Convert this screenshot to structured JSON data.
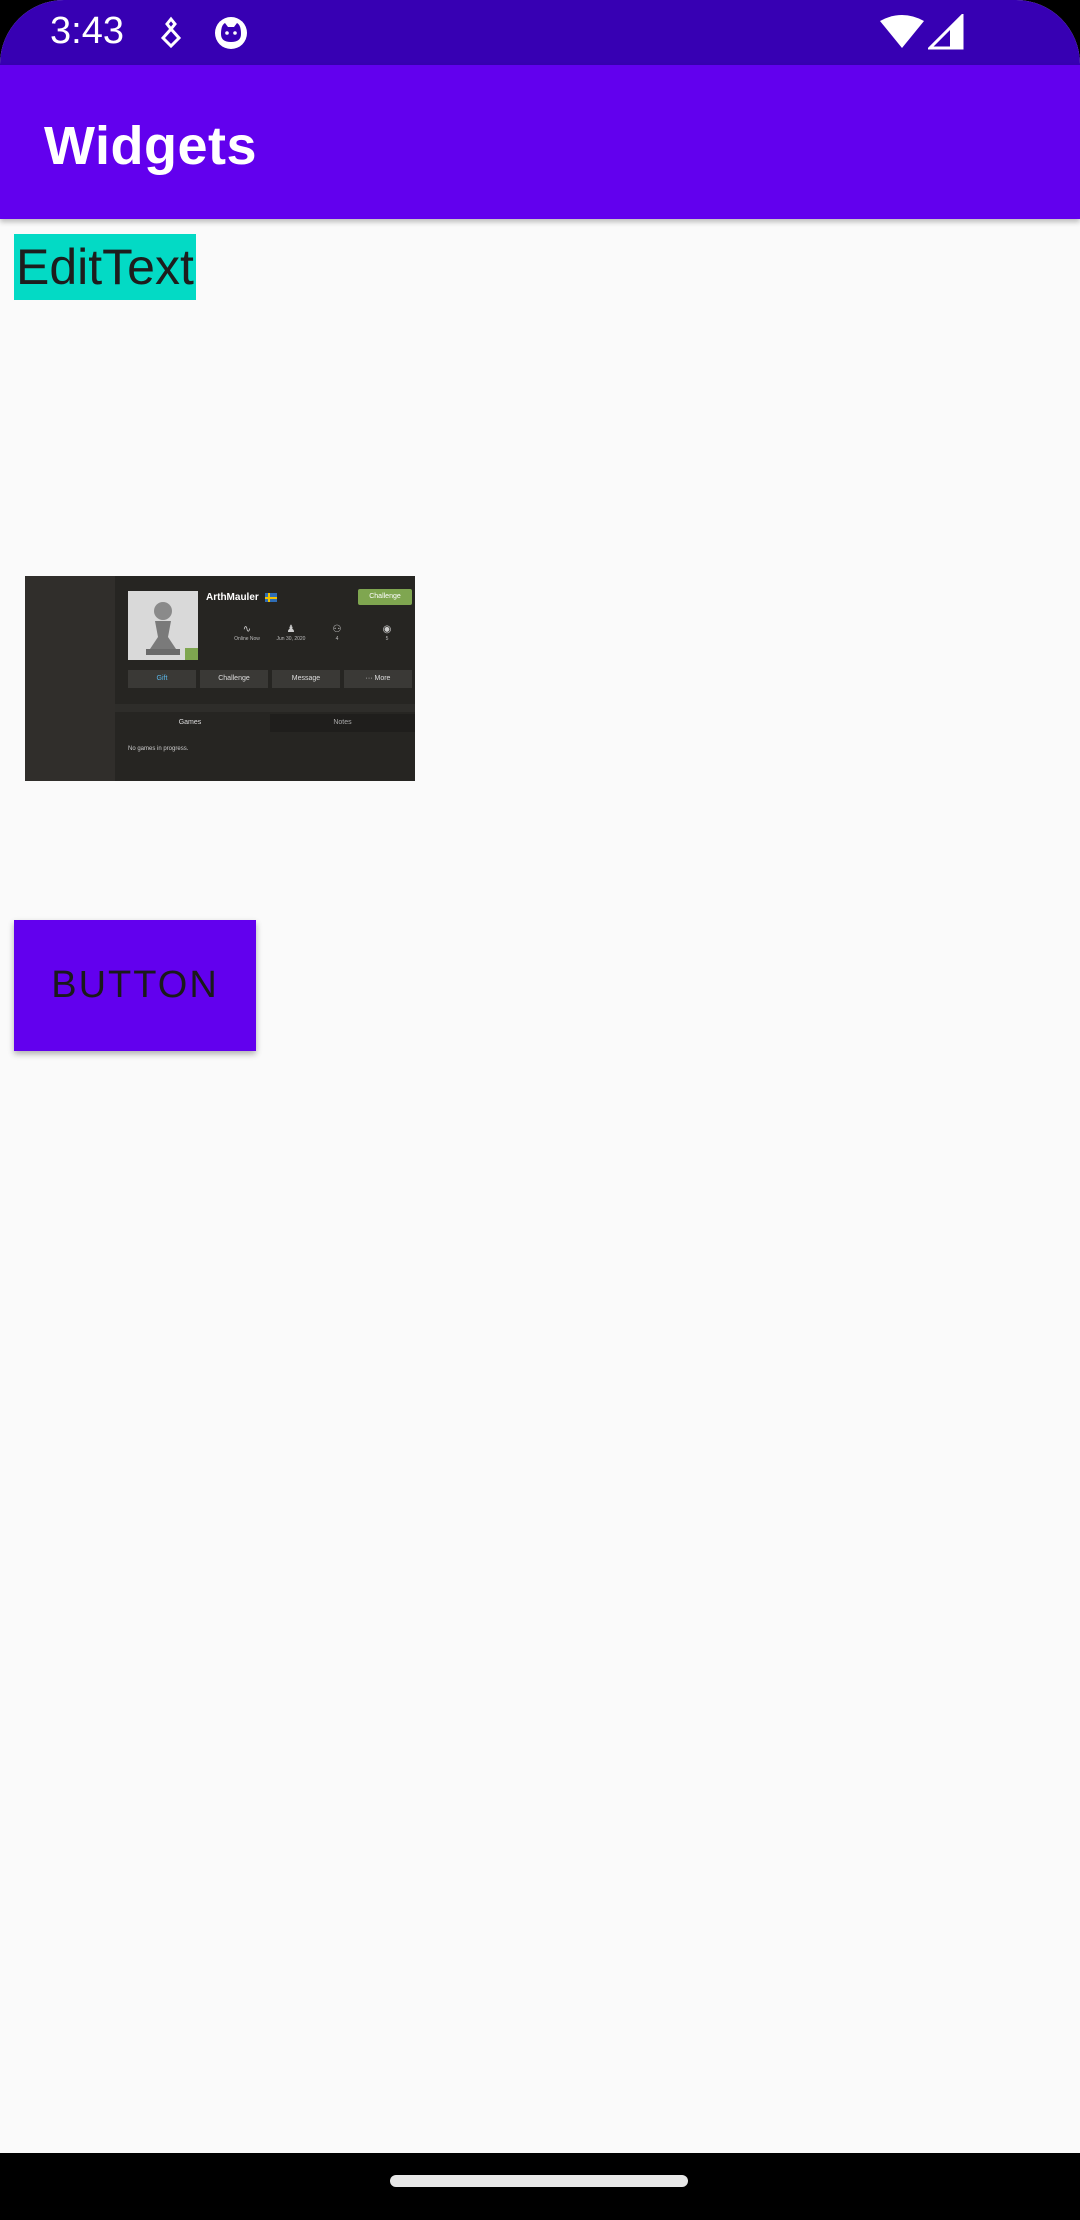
{
  "status_bar": {
    "time": "3:43",
    "icons": [
      "notification-app-icon",
      "cat-face-icon",
      "wifi-icon",
      "cell-signal-icon"
    ]
  },
  "app_bar": {
    "title": "Widgets"
  },
  "edit_text": {
    "value": "EditText"
  },
  "image": {
    "username": "ArthMauler",
    "challenge_label": "Challenge",
    "stats": [
      {
        "icon": "activity-icon",
        "text": "Online Now"
      },
      {
        "icon": "person-icon",
        "text": "Jun 30, 2020"
      },
      {
        "icon": "friends-icon",
        "text": "4"
      },
      {
        "icon": "eye-icon",
        "text": "5"
      }
    ],
    "buttons": [
      "Gift",
      "Challenge",
      "Message",
      "··· More"
    ],
    "tabs": [
      "Games",
      "Notes"
    ],
    "empty_text": "No games in progress."
  },
  "button": {
    "label": "BUTTON"
  },
  "colors": {
    "status_bar": "#3700b3",
    "primary": "#6200ee",
    "accent": "#03dac5",
    "background": "#fafafa"
  }
}
